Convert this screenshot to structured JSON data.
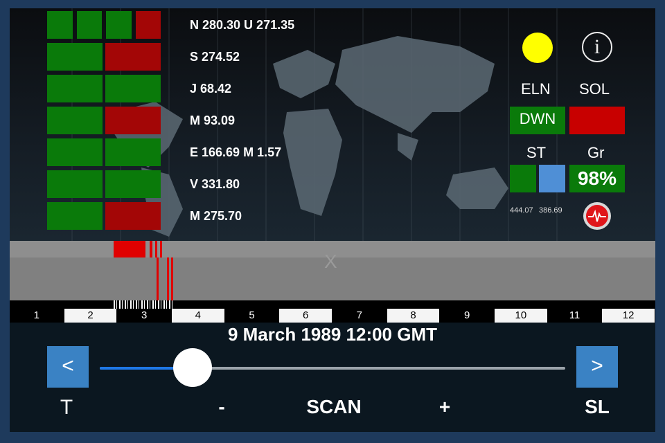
{
  "grid_cells": [
    [
      "g",
      "g",
      "g",
      "r"
    ],
    [
      "g",
      "r"
    ],
    [
      "g",
      "g"
    ],
    [
      "g",
      "r"
    ],
    [
      "g",
      "g"
    ],
    [
      "g",
      "g"
    ],
    [
      "g",
      "r"
    ]
  ],
  "planets": [
    "N 280.30 U 271.35",
    "S 274.52",
    "J 68.42",
    "M 93.09",
    "E 166.69 M 1.57",
    "V 331.80",
    "M 275.70"
  ],
  "status": {
    "sun_icon": "sun-icon",
    "info_icon": "info-icon",
    "eln_label": "ELN",
    "sol_label": "SOL",
    "eln_value": "DWN",
    "st_label": "ST",
    "gr_label": "Gr",
    "gr_value": "98%",
    "small_left": "444.07",
    "small_right": "386.69",
    "pulse_icon": "heartbeat-icon"
  },
  "strip": {
    "center_mark": "X"
  },
  "months": [
    "1",
    "2",
    "3",
    "4",
    "5",
    "6",
    "7",
    "8",
    "9",
    "10",
    "11",
    "12"
  ],
  "date_text": "9 March 1989 12:00 GMT",
  "controls": {
    "prev_label": "<",
    "next_label": ">",
    "t_label": "T",
    "minus_label": "-",
    "scan_label": "SCAN",
    "plus_label": "+",
    "sl_label": "SL"
  },
  "slider": {
    "value": 0.2
  },
  "colors": {
    "green": "#0a7a0a",
    "red": "#a30606",
    "accent_blue": "#3a82c4",
    "slider_fill": "#1f78e6",
    "sun": "#ffff00"
  }
}
